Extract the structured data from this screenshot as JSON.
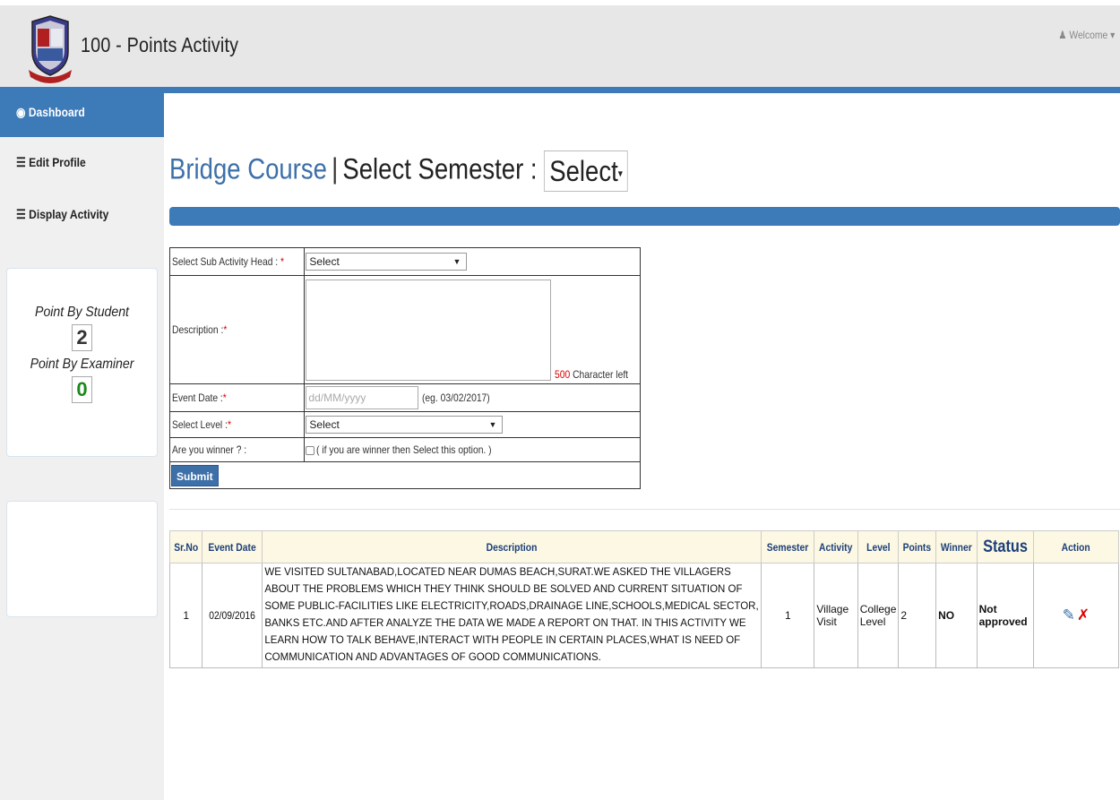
{
  "header": {
    "app_title": "100 - Points Activity",
    "welcome": "Welcome"
  },
  "sidebar": {
    "items": [
      {
        "icon": "dashboard-icon",
        "label": "Dashboard"
      },
      {
        "icon": "list-icon",
        "label": "Edit Profile"
      },
      {
        "icon": "list-icon",
        "label": "Display Activity"
      }
    ],
    "points": {
      "student_label": "Point By Student",
      "student_value": "2",
      "examiner_label": "Point By Examiner",
      "examiner_value": "0"
    }
  },
  "page": {
    "course": "Bridge Course",
    "separator": "|",
    "semester_label": "Select Semester :",
    "semester_value": "Select"
  },
  "form": {
    "sub_activity_label": "Select Sub Activity Head :",
    "sub_activity_value": "Select",
    "description_label": "Description :",
    "char_count": "500",
    "char_suffix": "Character left",
    "event_date_label": "Event Date :",
    "event_date_placeholder": "dd/MM/yyyy",
    "event_date_hint": "(eg. 03/02/2017)",
    "level_label": "Select Level :",
    "level_value": "Select",
    "winner_label": "Are you winner ? :",
    "winner_hint": "( if you are winner then Select this option. )",
    "submit_label": "Submit"
  },
  "table": {
    "headers": {
      "srno": "Sr.No",
      "event_date": "Event Date",
      "description": "Description",
      "semester": "Semester",
      "activity": "Activity",
      "level": "Level",
      "points": "Points",
      "winner": "Winner",
      "status": "Status",
      "action": "Action"
    },
    "rows": [
      {
        "srno": "1",
        "event_date": "02/09/2016",
        "description": "WE VISITED SULTANABAD,LOCATED NEAR DUMAS BEACH,SURAT.WE ASKED THE VILLAGERS ABOUT THE PROBLEMS WHICH THEY THINK SHOULD BE SOLVED AND CURRENT SITUATION OF SOME PUBLIC-FACILITIES LIKE ELECTRICITY,ROADS,DRAINAGE LINE,SCHOOLS,MEDICAL SECTOR, BANKS ETC.AND AFTER ANALYZE THE DATA WE MADE A REPORT ON THAT. IN THIS ACTIVITY WE LEARN HOW TO TALK BEHAVE,INTERACT WITH PEOPLE IN CERTAIN PLACES,WHAT IS NEED OF COMMUNICATION AND ADVANTAGES OF GOOD COMMUNICATIONS.",
        "semester": "1",
        "activity": "Village Visit",
        "level": "College Level",
        "points": "2",
        "winner": "NO",
        "status": "Not approved"
      }
    ]
  },
  "colors": {
    "primary": "#3d7ab8",
    "header_bg": "#e7e7e7",
    "required": "#dd0000",
    "status_green": "#1a8a1a",
    "table_header_bg": "#fcf8e3"
  }
}
